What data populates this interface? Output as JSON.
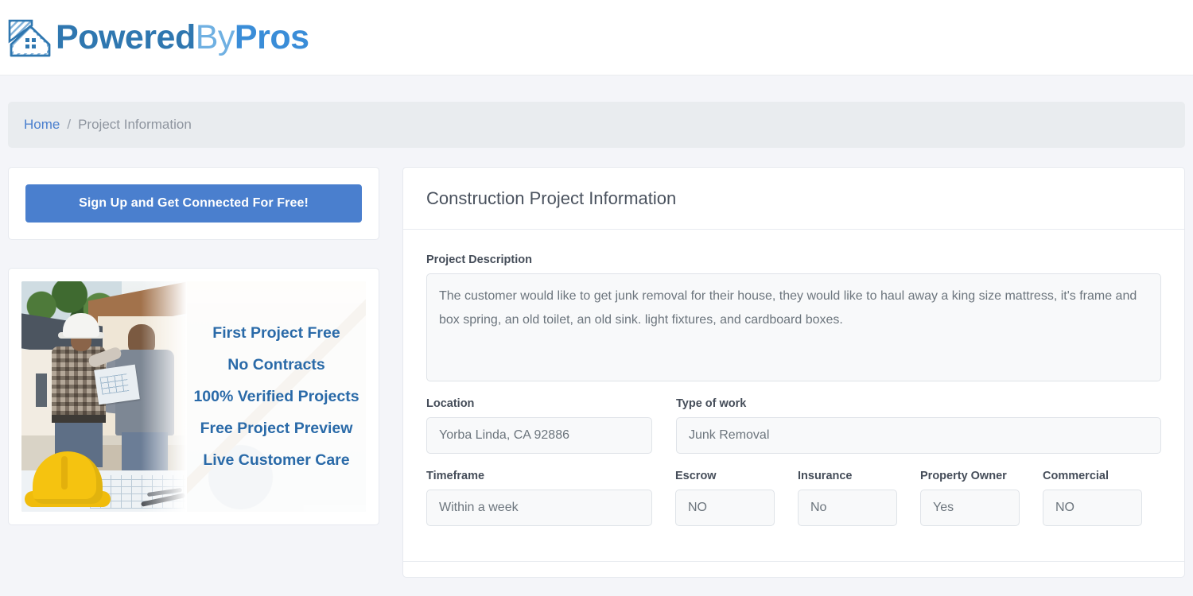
{
  "header": {
    "brand": {
      "logo_icon": "house-roof-icon",
      "word1": "Powered",
      "word2": "By",
      "word3": "Pros"
    }
  },
  "breadcrumb": {
    "home_label": "Home",
    "separator": "/",
    "current_label": "Project Information"
  },
  "sidebar": {
    "signup_button_label": "Sign Up and Get Connected For Free!",
    "promo": {
      "photo_alt": "two construction workers with hardhats reviewing blueprints",
      "lines": [
        "First Project Free",
        "No Contracts",
        "100% Verified Projects",
        "Free Project Preview",
        "Live Customer Care"
      ]
    }
  },
  "main": {
    "title": "Construction Project Information",
    "description": {
      "label": "Project Description",
      "value": "The customer would like to get junk removal for their house, they would like to haul away a king size mattress, it's frame and box spring, an old toilet, an old sink. light fixtures, and cardboard boxes."
    },
    "fields": {
      "location": {
        "label": "Location",
        "value": "Yorba Linda, CA 92886"
      },
      "type_of_work": {
        "label": "Type of work",
        "value": "Junk Removal"
      },
      "timeframe": {
        "label": "Timeframe",
        "value": "Within a week"
      },
      "escrow": {
        "label": "Escrow",
        "value": "NO"
      },
      "insurance": {
        "label": "Insurance",
        "value": "No"
      },
      "property_owner": {
        "label": "Property Owner",
        "value": "Yes"
      },
      "commercial": {
        "label": "Commercial",
        "value": "NO"
      }
    }
  },
  "colors": {
    "brand_dark_blue": "#2f77b0",
    "brand_light_blue": "#6fb0e2",
    "brand_mid_blue": "#3a8dd8",
    "button_blue": "#4a7fce",
    "page_background": "#f4f5f9",
    "breadcrumb_background": "#e9ecef",
    "promo_text_blue": "#2a6aa8",
    "readonly_field_background": "#f8f9fa"
  }
}
